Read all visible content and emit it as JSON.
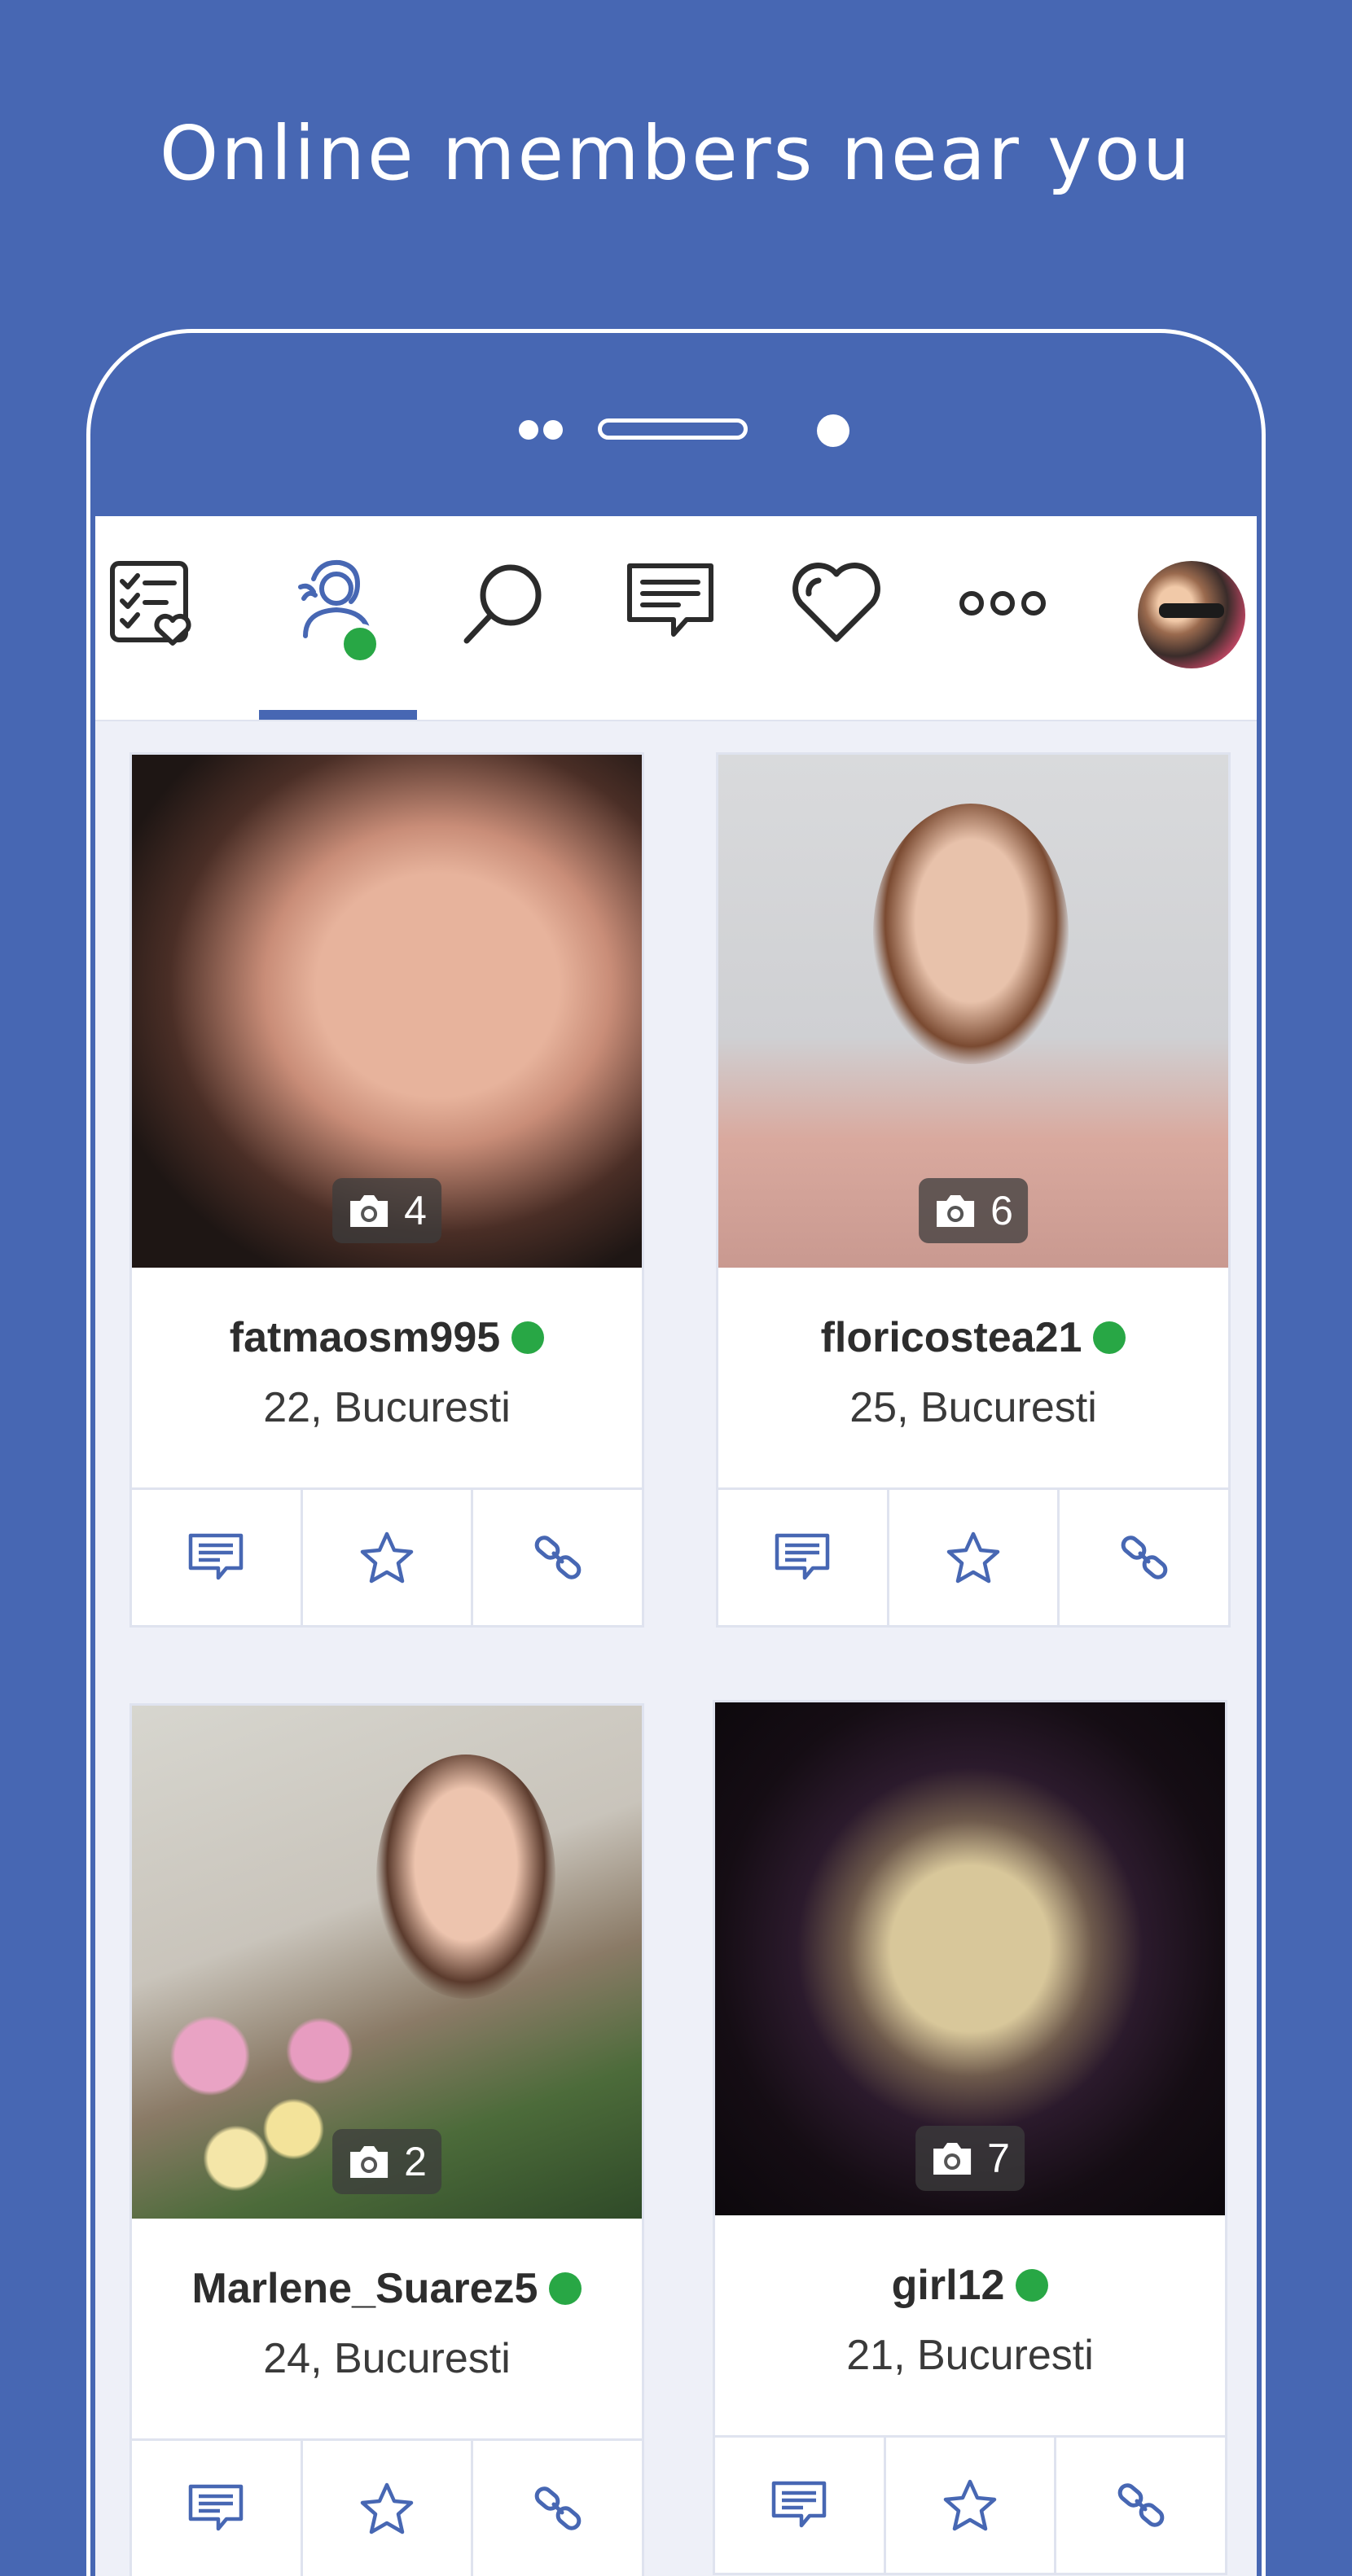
{
  "headline": "Online members near you",
  "colors": {
    "brand": "#4767b3",
    "online": "#28a745",
    "icon": "#4767b3"
  },
  "nav": {
    "items": [
      {
        "id": "checklist-heart",
        "icon": "checklist-heart-icon",
        "selected": false
      },
      {
        "id": "online-members",
        "icon": "online-user-icon",
        "selected": true
      },
      {
        "id": "search",
        "icon": "search-icon",
        "selected": false
      },
      {
        "id": "messages",
        "icon": "message-icon",
        "selected": false
      },
      {
        "id": "favorites",
        "icon": "heart-icon",
        "selected": false
      },
      {
        "id": "more",
        "icon": "more-dots-icon",
        "selected": false
      },
      {
        "id": "profile",
        "icon": "avatar",
        "selected": false
      }
    ]
  },
  "members": [
    {
      "username": "fatmaosm995",
      "age_location": "22, Bucuresti",
      "photo_count": "4",
      "online": true
    },
    {
      "username": "floricostea21",
      "age_location": "25, Bucuresti",
      "photo_count": "6",
      "online": true
    },
    {
      "username": "Marlene_Suarez5",
      "age_location": "24, Bucuresti",
      "photo_count": "2",
      "online": true
    },
    {
      "username": "girl12",
      "age_location": "21, Bucuresti",
      "photo_count": "7",
      "online": true
    }
  ],
  "card_actions": [
    "message-icon",
    "star-icon",
    "link-icon"
  ]
}
